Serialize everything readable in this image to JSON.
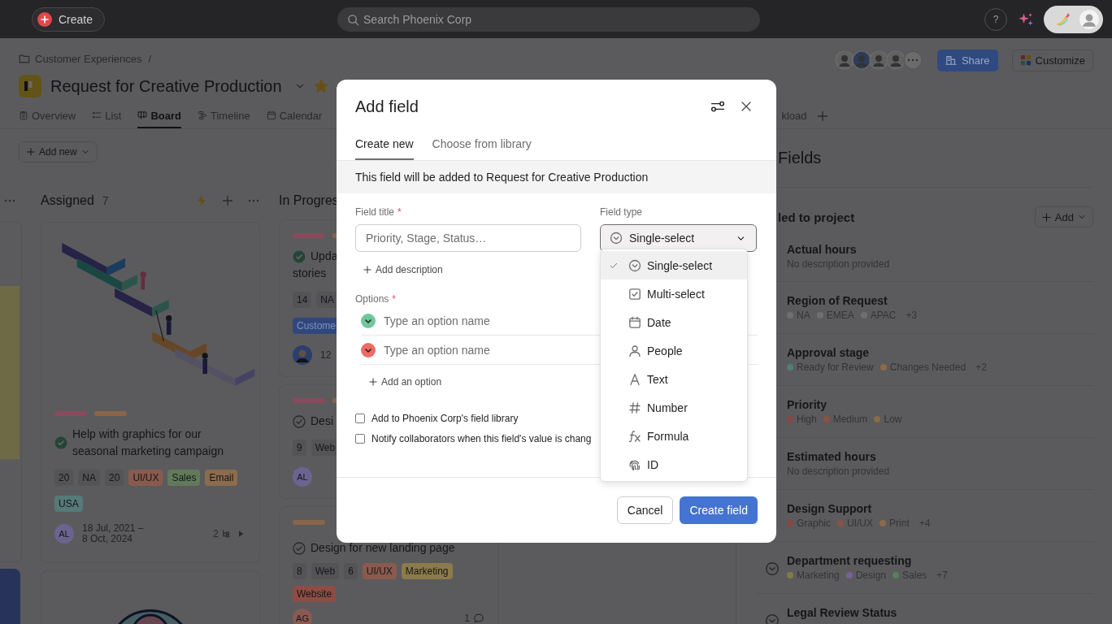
{
  "topbar": {
    "create_label": "Create",
    "search_placeholder": "Search Phoenix Corp",
    "help": "?"
  },
  "breadcrumb": {
    "folder": "Customer Experiences",
    "separator": "/"
  },
  "project": {
    "title": "Request for Creative Production",
    "starred": true
  },
  "share_label": "Share",
  "customize_label": "Customize",
  "tabs": [
    {
      "label": "Overview",
      "kind": "overview",
      "selected": false
    },
    {
      "label": "List",
      "kind": "list",
      "selected": false
    },
    {
      "label": "Board",
      "kind": "board",
      "selected": true
    },
    {
      "label": "Timeline",
      "kind": "timeline",
      "selected": false
    },
    {
      "label": "Calendar",
      "kind": "calendar",
      "selected": false
    },
    {
      "label": "kload",
      "kind": "cut",
      "selected": false
    }
  ],
  "add_new": "Add new",
  "board": {
    "columns": [
      {
        "kind": "partial"
      },
      {
        "kind": "full",
        "title": "Assigned",
        "count": "7",
        "cards": [
          {
            "kind": "stairs",
            "bars": [
              {
                "color": "#8a4a5c"
              },
              {
                "color": "#8a6549"
              }
            ],
            "completed": true,
            "title_lines": [
              "Help with graphics for our seasonal marketing campaign"
            ],
            "tag_rows": [
              [
                {
                  "text": "20",
                  "color": "#545456"
                },
                {
                  "text": "NA",
                  "color": "#545456"
                },
                {
                  "text": "20",
                  "color": "#545456"
                },
                {
                  "text": "UI/UX",
                  "color": "#8a5a4f"
                },
                {
                  "text": "Sales",
                  "color": "#617a5b"
                },
                {
                  "text": "Email",
                  "color": "#8c6c4d"
                }
              ],
              [
                {
                  "text": "USA",
                  "color": "#557a77"
                }
              ]
            ],
            "assignee": {
              "kind": "initials",
              "text": "AL",
              "color": "#6c6490"
            },
            "date": "18 Jul, 2021 – 8 Oct, 2024",
            "subtasks": "2"
          },
          {
            "kind": "circle"
          }
        ]
      },
      {
        "kind": "cut",
        "title": "In Progres",
        "cards": [
          {
            "kind": "plain",
            "bars": [
              {
                "color": "#8a4a5c"
              },
              {
                "color": "#8a6549"
              }
            ],
            "completed": true,
            "title_lines": [
              "Upda",
              "stories"
            ],
            "tag_rows": [
              [
                {
                  "text": "14",
                  "color": "#545456"
                },
                {
                  "text": "NA",
                  "color": "#545456"
                }
              ],
              [
                {
                  "text": "Custome",
                  "color": "#31477c"
                }
              ]
            ],
            "assignee": {
              "kind": "photo"
            },
            "date": "12"
          },
          {
            "kind": "plain",
            "bars": [
              {
                "color": "#8a4a5c"
              },
              {
                "color": "#8a6549"
              }
            ],
            "completed": false,
            "title_lines": [
              "Desi"
            ],
            "tag_rows": [
              [
                {
                  "text": "9",
                  "color": "#545456"
                },
                {
                  "text": "Web",
                  "color": "#545456"
                }
              ]
            ],
            "assignee": {
              "kind": "initials",
              "text": "AL",
              "color": "#6c6490"
            }
          },
          {
            "kind": "plain",
            "bars": [
              {
                "color": "#8a6549"
              }
            ],
            "completed": false,
            "title_lines": [
              "Design for new landing page"
            ],
            "tag_rows": [
              [
                {
                  "text": "8",
                  "color": "#545456"
                },
                {
                  "text": "Web",
                  "color": "#545456"
                },
                {
                  "text": "6",
                  "color": "#545456"
                },
                {
                  "text": "UI/UX",
                  "color": "#8a5a4f"
                },
                {
                  "text": "Marketing",
                  "color": "#8b7b4a"
                }
              ],
              [
                {
                  "text": "Website",
                  "color": "#8e4c45"
                }
              ]
            ],
            "assignee": {
              "kind": "initials",
              "text": "AG",
              "color": "#8a5a52"
            },
            "comments": "1"
          }
        ]
      }
    ]
  },
  "fields_panel": {
    "title": "Fields",
    "section": "led to project",
    "add_label": "Add",
    "fields": [
      {
        "name": "Actual hours",
        "description": "No description provided"
      },
      {
        "name": "Region of Request",
        "options": [
          {
            "label": "NA",
            "color": "#6f6f71"
          },
          {
            "label": "EMEA",
            "color": "#6f6f71"
          },
          {
            "label": "APAC",
            "color": "#6f6f71"
          }
        ],
        "more": "+3"
      },
      {
        "name": "Approval stage",
        "options": [
          {
            "label": "Ready for Review",
            "color": "#4f7d7a"
          },
          {
            "label": "Changes Needed",
            "color": "#8c6a4b"
          }
        ],
        "more": "+2"
      },
      {
        "name": "Priority",
        "options": [
          {
            "label": "High",
            "color": "#8a4744"
          },
          {
            "label": "Medium",
            "color": "#8a5148"
          },
          {
            "label": "Low",
            "color": "#8b6a45"
          }
        ]
      },
      {
        "name": "Estimated hours",
        "description": "No description provided"
      },
      {
        "name": "Design Support",
        "options": [
          {
            "label": "Graphic",
            "color": "#8a4744"
          },
          {
            "label": "UI/UX",
            "color": "#8a5148"
          },
          {
            "label": "Print",
            "color": "#8c6a4b"
          }
        ],
        "more": "+4"
      },
      {
        "name": "Department requesting",
        "kind": "single-select",
        "options": [
          {
            "label": "Marketing",
            "color": "#857a45"
          },
          {
            "label": "Design",
            "color": "#76629a"
          },
          {
            "label": "Sales",
            "color": "#5c7e5a"
          }
        ],
        "more": "+7"
      },
      {
        "name": "Legal Review Status",
        "kind": "single-select"
      }
    ]
  },
  "modal": {
    "title": "Add field",
    "tabs": [
      {
        "label": "Create new",
        "selected": true
      },
      {
        "label": "Choose from library",
        "selected": false
      }
    ],
    "banner": "This field will be added to Request for Creative Production",
    "field_title": {
      "label": "Field title",
      "required_mark": "*",
      "placeholder": "Priority, Stage, Status…"
    },
    "field_type": {
      "label": "Field type",
      "value": "Single-select",
      "kind": "single-select",
      "expanded": true
    },
    "add_description": "Add description",
    "options_label": "Options",
    "options_required_mark": "*",
    "options": [
      {
        "placeholder": "Type an option name",
        "color": "#6fc79b"
      },
      {
        "placeholder": "Type an option name",
        "color": "#ee6a64"
      }
    ],
    "add_option": "Add an option",
    "checkboxes": [
      {
        "label": "Add to Phoenix Corp's field library",
        "checked": false
      },
      {
        "label": "Notify collaborators when this field's value is chang",
        "checked": false
      }
    ],
    "cancel": "Cancel",
    "submit": "Create field"
  },
  "type_menu": [
    {
      "label": "Single-select",
      "kind": "single-select",
      "selected": true
    },
    {
      "label": "Multi-select",
      "kind": "multi-select",
      "selected": false
    },
    {
      "label": "Date",
      "kind": "date",
      "selected": false
    },
    {
      "label": "People",
      "kind": "people",
      "selected": false
    },
    {
      "label": "Text",
      "kind": "text",
      "selected": false
    },
    {
      "label": "Number",
      "kind": "number",
      "selected": false
    },
    {
      "label": "Formula",
      "kind": "formula",
      "selected": false
    },
    {
      "label": "ID",
      "kind": "id",
      "selected": false
    }
  ]
}
